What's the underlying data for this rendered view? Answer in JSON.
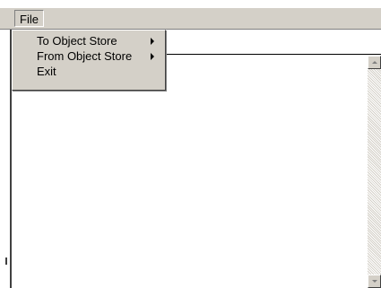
{
  "menubar": {
    "file_label": "File"
  },
  "file_menu": {
    "items": [
      {
        "label": "To Object Store",
        "has_submenu": true
      },
      {
        "label": "From Object Store",
        "has_submenu": true
      },
      {
        "label": "Exit",
        "has_submenu": false
      }
    ]
  },
  "colors": {
    "menu_background": "#d4d0c8",
    "content_background": "#ffffff",
    "text": "#000000"
  },
  "icons": {
    "submenu": "chevron-right-icon",
    "scroll_up": "arrow-up-icon",
    "scroll_down": "arrow-down-icon"
  }
}
